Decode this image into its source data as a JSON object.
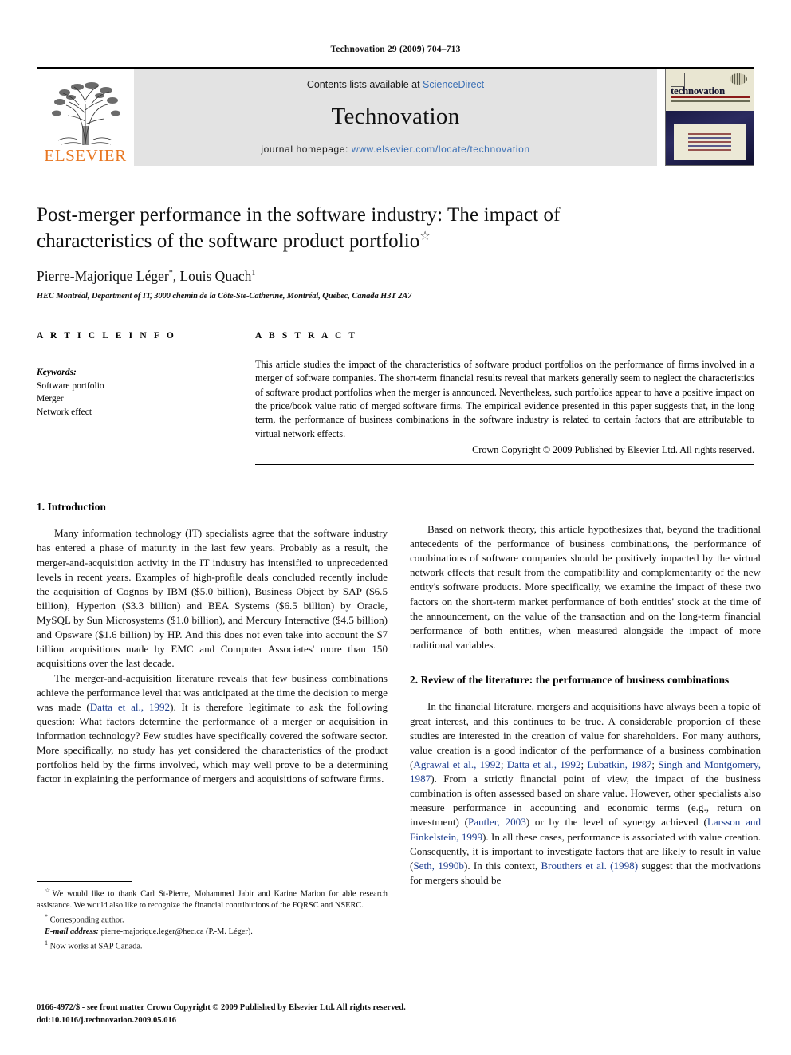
{
  "running_head": "Technovation 29 (2009) 704–713",
  "masthead": {
    "publisher_name": "ELSEVIER",
    "contents_prefix": "Contents lists available at ",
    "contents_link": "ScienceDirect",
    "journal_name": "Technovation",
    "homepage_prefix": "journal homepage: ",
    "homepage_url": "www.elsevier.com/locate/technovation",
    "cover_title": "technovation",
    "link_color": "#3a6fb5",
    "elsevier_orange": "#E87722"
  },
  "title": {
    "line1": "Post-merger performance in the software industry: The impact of",
    "line2": "characteristics of the software product portfolio",
    "footnote_marker": "☆"
  },
  "authors": {
    "name1": "Pierre-Majorique Léger",
    "marker1": "*",
    "separator": ", ",
    "name2": "Louis Quach",
    "marker2": "1"
  },
  "affiliation": "HEC Montréal, Department of IT, 3000 chemin de la Côte-Ste-Catherine, Montréal, Québec, Canada H3T 2A7",
  "article_info": {
    "heading": "A R T I C L E   I N F O",
    "keywords_heading": "Keywords:",
    "keywords": [
      "Software portfolio",
      "Merger",
      "Network effect"
    ]
  },
  "abstract": {
    "heading": "A B S T R A C T",
    "text": "This article studies the impact of the characteristics of software product portfolios on the performance of firms involved in a merger of software companies. The short-term financial results reveal that markets generally seem to neglect the characteristics of software product portfolios when the merger is announced. Nevertheless, such portfolios appear to have a positive impact on the price/book value ratio of merged software firms. The empirical evidence presented in this paper suggests that, in the long term, the performance of business combinations in the software industry is related to certain factors that are attributable to virtual network effects.",
    "copyright": "Crown Copyright © 2009 Published by Elsevier Ltd. All rights reserved."
  },
  "sections": {
    "intro_heading": "1. Introduction",
    "intro_p1": "Many information technology (IT) specialists agree that the software industry has entered a phase of maturity in the last few years. Probably as a result, the merger-and-acquisition activity in the IT industry has intensified to unprecedented levels in recent years. Examples of high-profile deals concluded recently include the acquisition of Cognos by IBM ($5.0 billion), Business Object by SAP ($6.5 billion), Hyperion ($3.3 billion) and BEA Systems ($6.5 billion) by Oracle, MySQL by Sun Microsystems ($1.0 billion), and Mercury Interactive ($4.5 billion) and Opsware ($1.6 billion) by HP. And this does not even take into account the $7 billion acquisitions made by EMC and Computer Associates' more than 150 acquisitions over the last decade.",
    "intro_p2_a": "The merger-and-acquisition literature reveals that few business combinations achieve the performance level that was anticipated at the time the decision to merge was made (",
    "intro_p2_cite1": "Datta et al., 1992",
    "intro_p2_b": "). It is therefore legitimate to ask the following question: What factors determine the performance of a merger or acquisition in information technology? Few studies have specifically covered the software sector. More specifically, no study has yet considered the characteristics of the product portfolios held by the firms involved, which may well prove to be a determining factor in explaining the performance of mergers and acquisitions of software firms.",
    "right_p1": "Based on network theory, this article hypothesizes that, beyond the traditional antecedents of the performance of business combinations, the performance of combinations of software companies should be positively impacted by the virtual network effects that result from the compatibility and complementarity of the new entity's software products. More specifically, we examine the impact of these two factors on the short-term market performance of both entities' stock at the time of the announcement, on the value of the transaction and on the long-term financial performance of both entities, when measured alongside the impact of more traditional variables.",
    "review_heading": "2. Review of the literature: the performance of business combinations",
    "review_p1_a": "In the financial literature, mergers and acquisitions have always been a topic of great interest, and this continues to be true. A considerable proportion of these studies are interested in the creation of value for shareholders. For many authors, value creation is a good indicator of the performance of a business combination (",
    "review_cite1": "Agrawal et al., 1992",
    "review_sep1": "; ",
    "review_cite2": "Datta et al., 1992",
    "review_sep2": "; ",
    "review_cite3": "Lubatkin, 1987",
    "review_sep3": "; ",
    "review_cite4": "Singh and Montgomery, 1987",
    "review_p1_b": "). From a strictly financial point of view, the impact of the business combination is often assessed based on share value. However, other specialists also measure performance in accounting and economic terms (e.g., return on investment) (",
    "review_cite5": "Pautler, 2003",
    "review_p1_c": ") or by the level of synergy achieved (",
    "review_cite6": "Larsson and Finkelstein, 1999",
    "review_p1_d": "). In all these cases, performance is associated with value creation. Consequently, it is important to investigate factors that are likely to result in value (",
    "review_cite7": "Seth, 1990b",
    "review_p1_e": "). In this context, ",
    "review_cite8": "Brouthers et al. (1998)",
    "review_p1_f": " suggest that the motivations for mergers should be"
  },
  "footnotes": {
    "star_marker": "☆",
    "acknowledgement": "We would like to thank Carl St-Pierre, Mohammed Jabir and Karine Marion for able research assistance. We would also like to recognize the financial contributions of the FQRSC and NSERC.",
    "corresponding_marker": "*",
    "corresponding": "Corresponding author.",
    "email_label": "E-mail address:",
    "email": "pierre-majorique.leger@hec.ca (P.-M. Léger).",
    "note1_marker": "1",
    "note1": "Now works at SAP Canada."
  },
  "page_footer": {
    "line1": "0166-4972/$ - see front matter Crown Copyright © 2009 Published by Elsevier Ltd. All rights reserved.",
    "line2": "doi:10.1016/j.technovation.2009.05.016"
  }
}
